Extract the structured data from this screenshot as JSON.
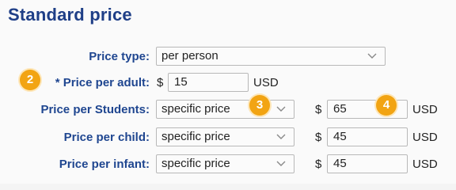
{
  "section": {
    "title": "Standard price"
  },
  "rows": {
    "price_type": {
      "label": "Price type:",
      "selected": "per person"
    },
    "adult": {
      "label": "* Price per adult:",
      "currency_symbol": "$",
      "value": "15",
      "currency": "USD"
    },
    "students": {
      "label": "Price per Students:",
      "selected": "specific price",
      "currency_symbol": "$",
      "value": "65",
      "currency": "USD"
    },
    "child": {
      "label": "Price per child:",
      "selected": "specific price",
      "currency_symbol": "$",
      "value": "45",
      "currency": "USD"
    },
    "infant": {
      "label": "Price per infant:",
      "selected": "specific price",
      "currency_symbol": "$",
      "value": "45",
      "currency": "USD"
    }
  },
  "badges": [
    "2",
    "3",
    "4"
  ],
  "colors": {
    "label": "#1f4690",
    "badge": "#f2a413"
  },
  "icons": {
    "dropdown": "chevron-down-icon"
  }
}
